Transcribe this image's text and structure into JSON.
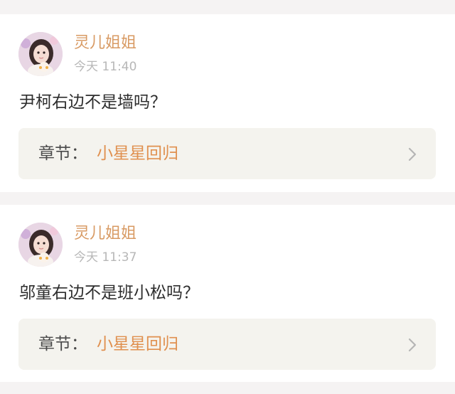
{
  "comments": [
    {
      "username": "灵儿姐姐",
      "timestamp": "今天 11:40",
      "text": "尹柯右边不是墙吗？",
      "chapter_prefix": "章节：",
      "chapter_title": "小星星回归"
    },
    {
      "username": "灵儿姐姐",
      "timestamp": "今天 11:37",
      "text": "邬童右边不是班小松吗？",
      "chapter_prefix": "章节：",
      "chapter_title": "小星星回归"
    }
  ],
  "colors": {
    "username": "#d89a63",
    "chapter_title": "#e0904f",
    "timestamp": "#b7b7b7",
    "page_bg": "#f5f3f3",
    "chapter_bg": "#f4f3ee"
  },
  "icons": {
    "chevron": "chevron-right-icon"
  }
}
